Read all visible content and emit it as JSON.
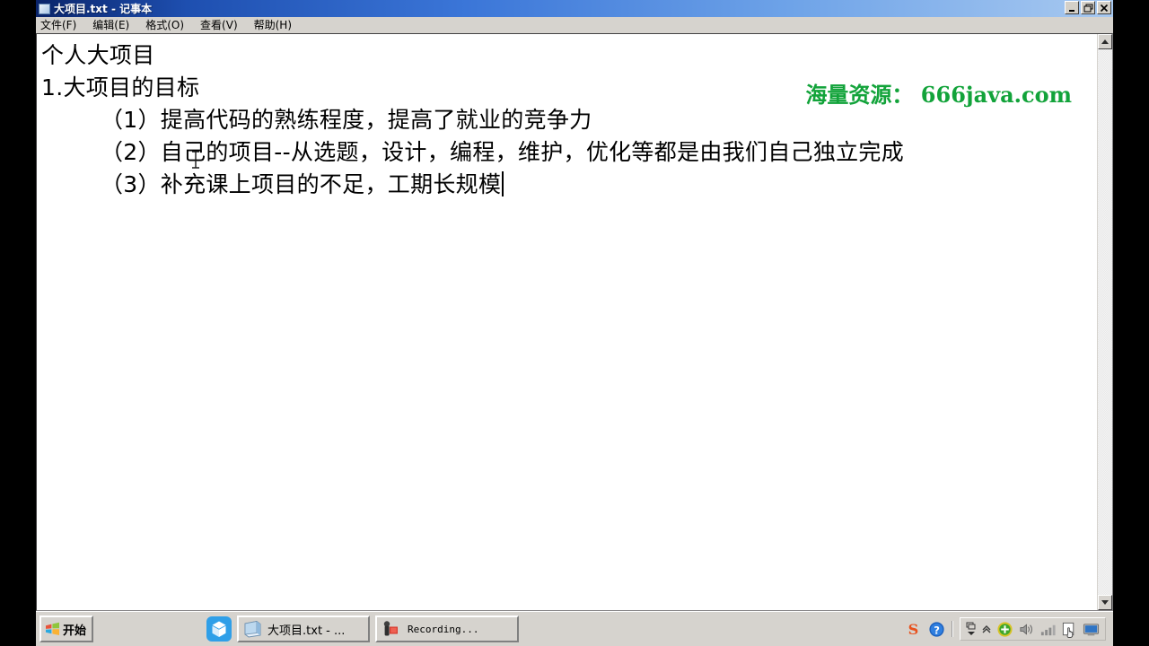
{
  "window": {
    "title": "大项目.txt - 记事本",
    "icon": "notepad-icon",
    "menus": [
      {
        "label": "文件(F)",
        "name": "menu-file"
      },
      {
        "label": "编辑(E)",
        "name": "menu-edit"
      },
      {
        "label": "格式(O)",
        "name": "menu-format"
      },
      {
        "label": "查看(V)",
        "name": "menu-view"
      },
      {
        "label": "帮助(H)",
        "name": "menu-help"
      }
    ],
    "controls": {
      "minimize": "minimize-icon",
      "restore": "restore-icon",
      "close": "close-icon"
    }
  },
  "document": {
    "lines": [
      "个人大项目",
      "1.大项目的目标",
      "        （1）提高代码的熟练程度，提高了就业的竞争力",
      "        （2）自己的项目--从选题，设计，编程，维护，优化等都是由我们自己独立完成",
      "        （3）补充课上项目的不足，工期长规模"
    ],
    "watermark": "海量资源： 666java.com",
    "watermark_color": "#12a33a",
    "caret_visible": true
  },
  "scrollbar": {
    "up_arrow": "scroll-up-icon",
    "down_arrow": "scroll-down-icon"
  },
  "taskbar": {
    "start_label": "开始",
    "quick_launch": [
      {
        "name": "virtualbox-icon",
        "title": ""
      }
    ],
    "tasks": [
      {
        "name": "taskbar-item-notepad",
        "label": "大项目.txt - ...",
        "icon": "notepad-icon"
      },
      {
        "name": "taskbar-item-recording",
        "label": "Recording...",
        "icon": "camcorder-icon"
      }
    ],
    "tray": [
      {
        "name": "sogou-icon"
      },
      {
        "name": "help-icon"
      },
      {
        "name": "ime-keyboard-icon"
      },
      {
        "name": "ime-chevron-down-icon"
      },
      {
        "name": "ime-expand-icon"
      },
      {
        "name": "update-icon"
      },
      {
        "name": "volume-icon"
      },
      {
        "name": "signal-icon"
      },
      {
        "name": "safety-hand-icon"
      },
      {
        "name": "display-icon"
      }
    ]
  }
}
